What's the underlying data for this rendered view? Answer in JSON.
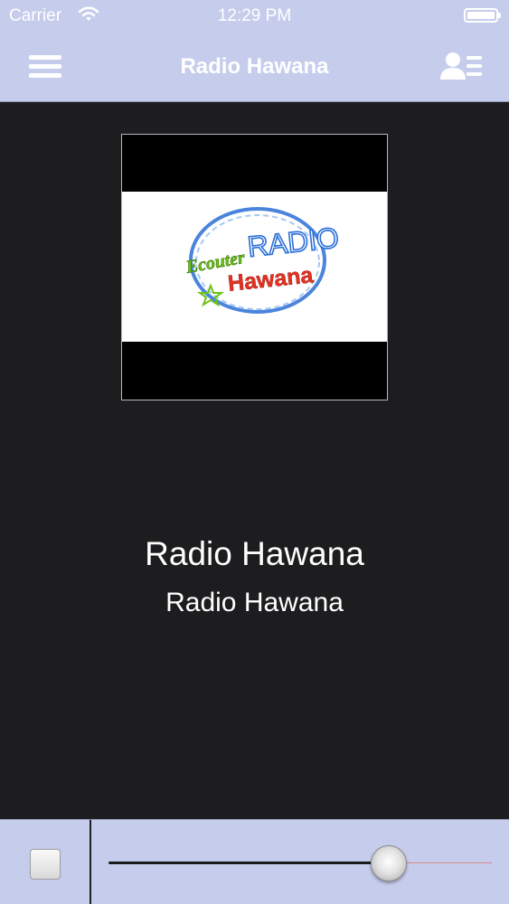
{
  "status_bar": {
    "carrier": "Carrier",
    "time": "12:29 PM",
    "wifi_icon": "wifi-icon",
    "battery_icon": "battery-icon"
  },
  "nav": {
    "title": "Radio Hawana",
    "menu_icon": "hamburger-menu-icon",
    "contact_icon": "contact-list-icon"
  },
  "artwork": {
    "logo_top": "Ecouter",
    "logo_main": "RADIO",
    "logo_sub": "Hawana"
  },
  "track": {
    "title": "Radio Hawana",
    "subtitle": "Radio Hawana"
  },
  "player": {
    "stop_icon": "stop-icon",
    "volume_level": 0.73
  },
  "colors": {
    "bar": "#c6cdec",
    "background": "#1d1d1f",
    "logo_blue": "#2a6fd6",
    "logo_red": "#e53223",
    "logo_green": "#6cc218"
  }
}
